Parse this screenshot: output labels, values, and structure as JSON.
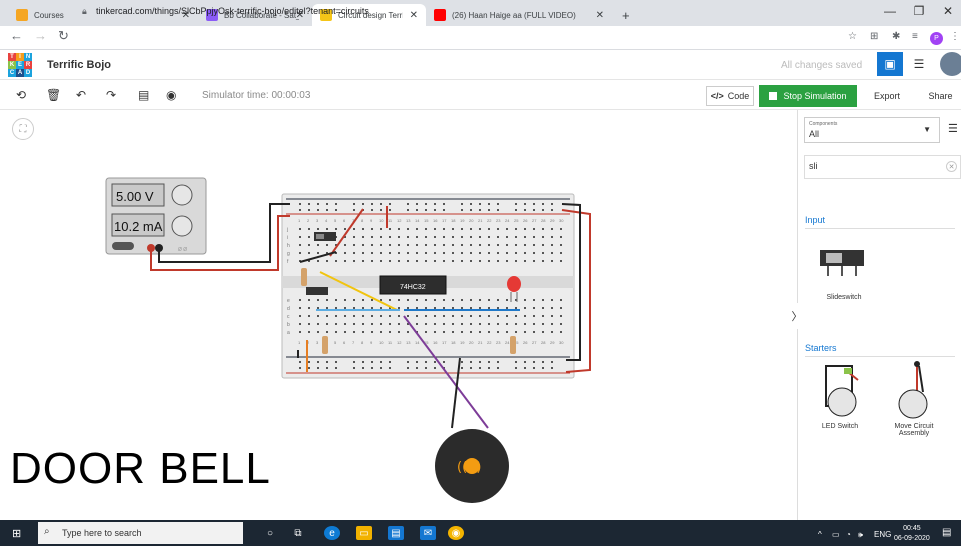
{
  "browser": {
    "tabs": [
      {
        "title": "Courses",
        "favicon_color": "#f5a623",
        "active": false
      },
      {
        "title": "Bb Collaborate - Sat_2_Practicali",
        "favicon_color": "#8b5cf6",
        "active": false
      },
      {
        "title": "Circuit design Terrific Bojo | T",
        "favicon_color": "#f5c518",
        "active": true
      },
      {
        "title": "(26) Haan Haige aa (FULL VIDEO)",
        "favicon_color": "#ff0000",
        "active": false
      }
    ],
    "new_tab": "+",
    "url": "tinkercad.com/things/SlCbPpjyOsk-terrific-bojo/editel?tenant=circuits",
    "profile_initial": "P"
  },
  "app": {
    "logo_letters": [
      "T",
      "I",
      "N",
      "K",
      "E",
      "R",
      "C",
      "A",
      "D"
    ],
    "project_name": "Terrific Bojo",
    "save_status": "All changes saved"
  },
  "toolbar": {
    "sim_time": "Simulator time: 00:00:03",
    "code_label": "Code",
    "stop_label": "Stop Simulation",
    "export_label": "Export",
    "share_label": "Share"
  },
  "workspace": {
    "title": "DOOR BELL",
    "power_supply": {
      "voltage": "5.00 V",
      "current": "10.2 mA"
    },
    "chip_label": "74HC32",
    "breadboard_columns": [
      "1",
      "2",
      "3",
      "4",
      "5",
      "6",
      "7",
      "8",
      "9",
      "10",
      "11",
      "12",
      "13",
      "14",
      "15",
      "16",
      "17",
      "18",
      "19",
      "20",
      "21",
      "22",
      "23",
      "24",
      "25",
      "26",
      "27",
      "28",
      "29",
      "30"
    ],
    "breadboard_rows_top": [
      "j",
      "i",
      "h",
      "g",
      "f"
    ],
    "breadboard_rows_bottom": [
      "e",
      "d",
      "c",
      "b",
      "a"
    ]
  },
  "panel": {
    "components_label": "Components",
    "components_value": "All",
    "search_value": "sli",
    "search_placeholder": "Search",
    "input_section": "Input",
    "slideswitch_label": "Slideswitch",
    "starters_section": "Starters",
    "starter_items": [
      {
        "label": "LED Switch"
      },
      {
        "label": "Move Circuit Assembly"
      }
    ]
  },
  "taskbar": {
    "search_placeholder": "Type here to search",
    "lang": "ENG",
    "time": "00:45",
    "date": "06-09-2020"
  }
}
